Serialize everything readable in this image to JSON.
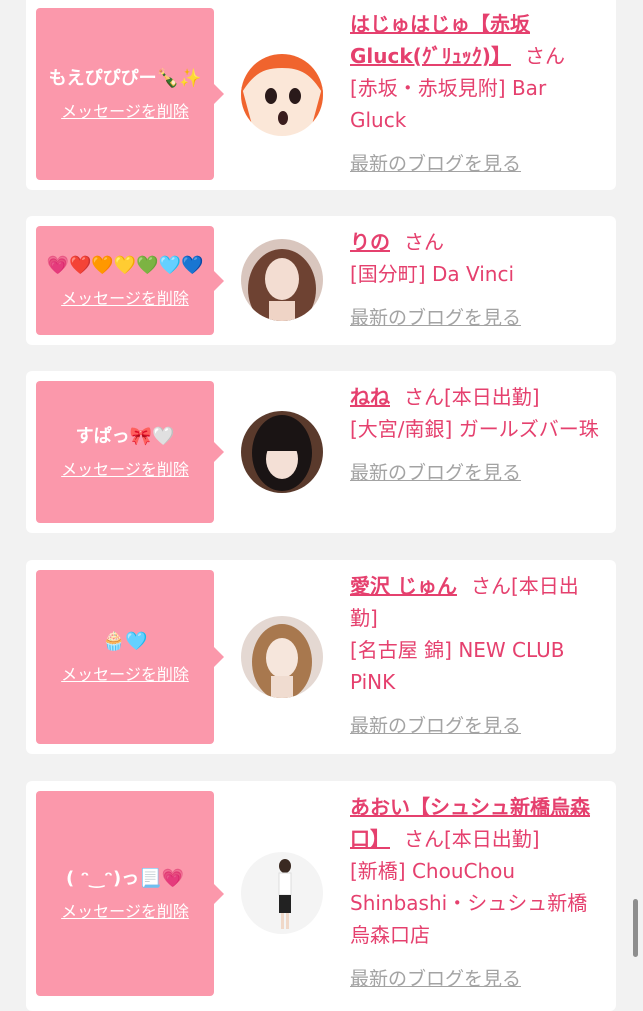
{
  "cards": [
    {
      "message": "もえぴぴぴー🍾✨",
      "delete_label": "メッセージを削除",
      "name": "はじゅはじゅ【赤坂Gluck(ｸﾞﾘｭｯｸ)】",
      "san": "さん",
      "status": "",
      "area": "[赤坂・赤坂見附] Bar Gluck",
      "blog_label": "最新のブログを見る",
      "avatar": "avatar-orange-anime"
    },
    {
      "message": "💗❤️🧡💛💚🩵💙",
      "delete_label": "メッセージを削除",
      "name": "りの",
      "san": "さん",
      "status": "",
      "area": "[国分町] Da Vinci",
      "blog_label": "最新のブログを見る",
      "avatar": "avatar-photo-brown-hair"
    },
    {
      "message": "すぱっ🎀🤍",
      "delete_label": "メッセージを削除",
      "name": "ねね",
      "san": "さん",
      "status": "[本日出勤]",
      "area": "[大宮/南銀] ガールズバー珠",
      "blog_label": "最新のブログを見る",
      "avatar": "avatar-photo-black-hair"
    },
    {
      "message": "🧁🩵",
      "delete_label": "メッセージを削除",
      "name": "愛沢 じゅん",
      "san": "さん",
      "status": "[本日出勤]",
      "area": "[名古屋 錦] NEW CLUB PiNK",
      "blog_label": "最新のブログを見る",
      "avatar": "avatar-photo-light-hair"
    },
    {
      "message": "( ᵔ‿ᵔ)っ📃💗",
      "delete_label": "メッセージを削除",
      "name": "あおい【シュシュ新橋烏森口】",
      "san": "さん",
      "status": "[本日出勤]",
      "area": "[新橋] ChouChou Shinbashi・シュシュ新橋烏森口店",
      "blog_label": "最新のブログを見る",
      "avatar": "avatar-photo-standing"
    }
  ],
  "colors": {
    "bubble": "#fb98ab",
    "accent": "#e5406e",
    "link_gray": "#a3a3a3",
    "background": "#f2f2f2"
  }
}
